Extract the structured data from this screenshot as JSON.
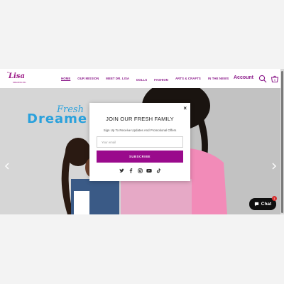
{
  "header": {
    "logo": {
      "top_small": "Dr.",
      "name": "Lisa",
      "tagline": "DREAMING BIG"
    },
    "nav": [
      {
        "label": "HOME",
        "active": true
      },
      {
        "label": "OUR MISSION",
        "active": false
      },
      {
        "label": "MEET DR. LISA",
        "active": false
      },
      {
        "label": "DOLLS",
        "active": false
      },
      {
        "label": "FASHION",
        "active": false
      },
      {
        "label": "ARTS & CRAFTS",
        "active": false
      },
      {
        "label": "IN THE NEWS",
        "active": false
      }
    ],
    "account_label": "Account",
    "cart_count": "0"
  },
  "hero": {
    "script_title": "Fresh",
    "title": "Dreame",
    "prev_icon": "chevron-left-icon",
    "next_icon": "chevron-right-icon"
  },
  "modal": {
    "close": "×",
    "title": "JOIN OUR FRESH FAMILY",
    "subtitle": "Sign Up To Receive Updates And Promotional Offers",
    "email_placeholder": "Your email",
    "subscribe_label": "SUBSCRIBE",
    "socials": [
      "twitter-icon",
      "facebook-icon",
      "instagram-icon",
      "youtube-icon",
      "tiktok-icon"
    ]
  },
  "chat": {
    "label": "Chat",
    "badge": "1"
  },
  "colors": {
    "brand": "#9a0a8c",
    "nav": "#8b1a8a",
    "hero_title": "#2aa1dc"
  }
}
